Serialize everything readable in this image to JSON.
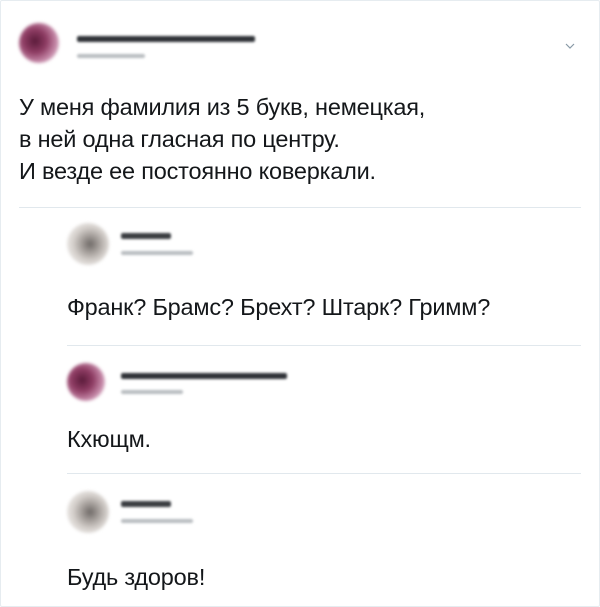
{
  "thread": {
    "main_post": {
      "text": "У меня фамилия из 5 букв, немецкая,\nв ней одна гласная по центру.\nИ везде ее постоянно коверкали.",
      "icons": {
        "chevron": "chevron-down-icon"
      }
    },
    "replies": [
      {
        "text": "Франк? Брамс? Брехт? Штарк? Гримм?"
      },
      {
        "text": "Кхющм."
      },
      {
        "text": "Будь здоров!"
      }
    ]
  }
}
